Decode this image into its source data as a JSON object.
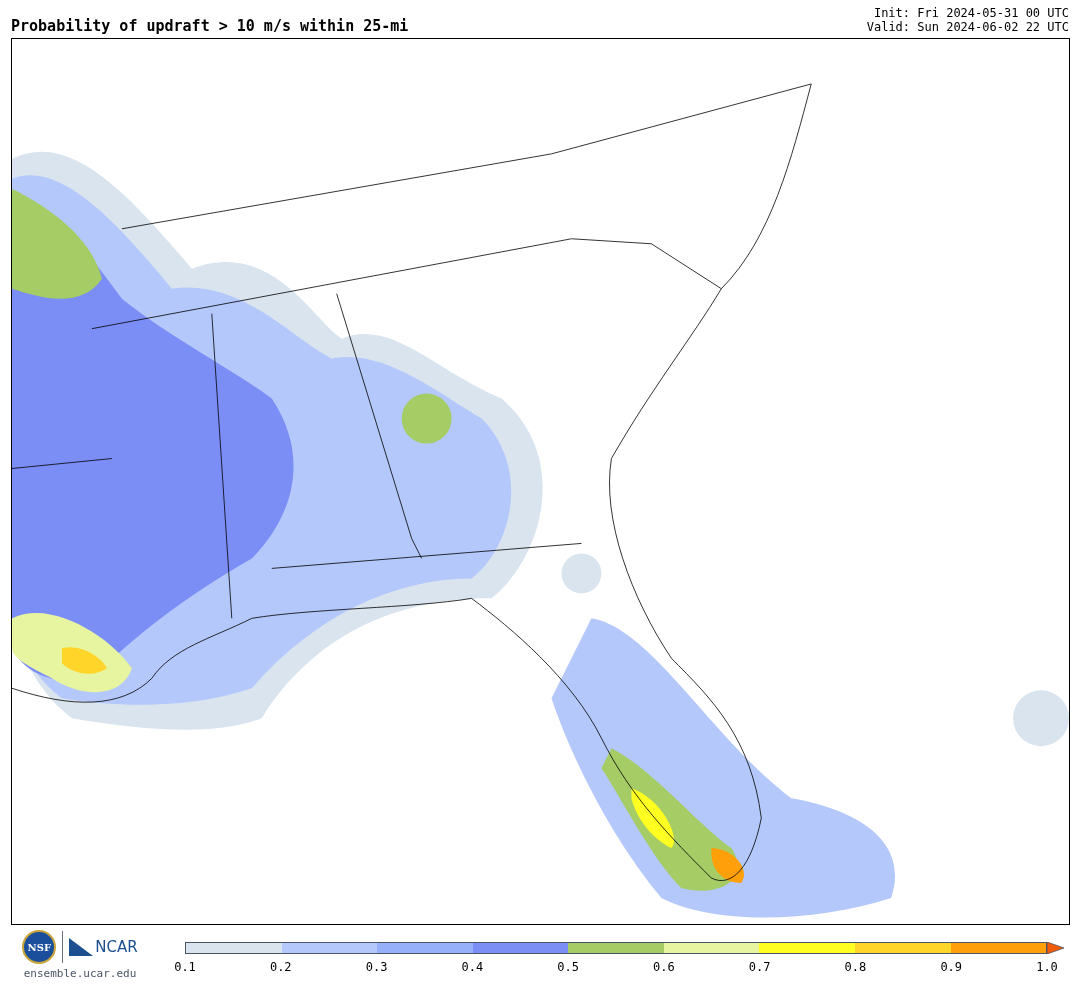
{
  "title": "Probability of updraft > 10 m/s within 25-mi",
  "init": "Init: Fri 2024-05-31 00 UTC",
  "valid": "Valid: Sun 2024-06-02 22 UTC",
  "logos": {
    "nsf": "NSF",
    "ncar": "NCAR",
    "site": "ensemble.ucar.edu"
  },
  "colorbar": {
    "segments": [
      {
        "color": "#d9e4ef"
      },
      {
        "color": "#b4c8fb"
      },
      {
        "color": "#96b0fa"
      },
      {
        "color": "#7b8ef5"
      },
      {
        "color": "#a6cc66"
      },
      {
        "color": "#e8f5a0"
      },
      {
        "color": "#ffff22"
      },
      {
        "color": "#ffd52a"
      },
      {
        "color": "#ff9f0a"
      }
    ],
    "extend": {
      "color": "#f05a0a"
    },
    "ticks": [
      "0.1",
      "0.2",
      "0.3",
      "0.4",
      "0.5",
      "0.6",
      "0.7",
      "0.8",
      "0.9",
      "1.0"
    ]
  }
}
